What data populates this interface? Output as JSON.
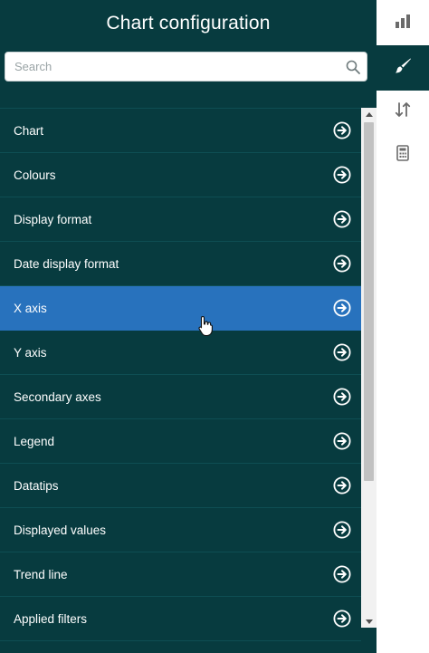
{
  "panel": {
    "title": "Chart configuration",
    "search": {
      "placeholder": "Search",
      "value": ""
    },
    "items": [
      {
        "label": "Chart"
      },
      {
        "label": "Colours"
      },
      {
        "label": "Display format"
      },
      {
        "label": "Date display format"
      },
      {
        "label": "X axis"
      },
      {
        "label": "Y axis"
      },
      {
        "label": "Secondary axes"
      },
      {
        "label": "Legend"
      },
      {
        "label": "Datatips"
      },
      {
        "label": "Displayed values"
      },
      {
        "label": "Trend line"
      },
      {
        "label": "Applied filters"
      }
    ],
    "active_item": "X axis"
  },
  "side_rail": {
    "buttons": [
      {
        "icon": "bar-chart-icon"
      },
      {
        "icon": "paintbrush-icon",
        "active": true
      },
      {
        "icon": "sort-arrows-icon"
      },
      {
        "icon": "calculator-icon"
      }
    ]
  },
  "colors": {
    "panel_bg": "#073b3f",
    "active_item": "#2872bd",
    "text": "#ffffff"
  }
}
